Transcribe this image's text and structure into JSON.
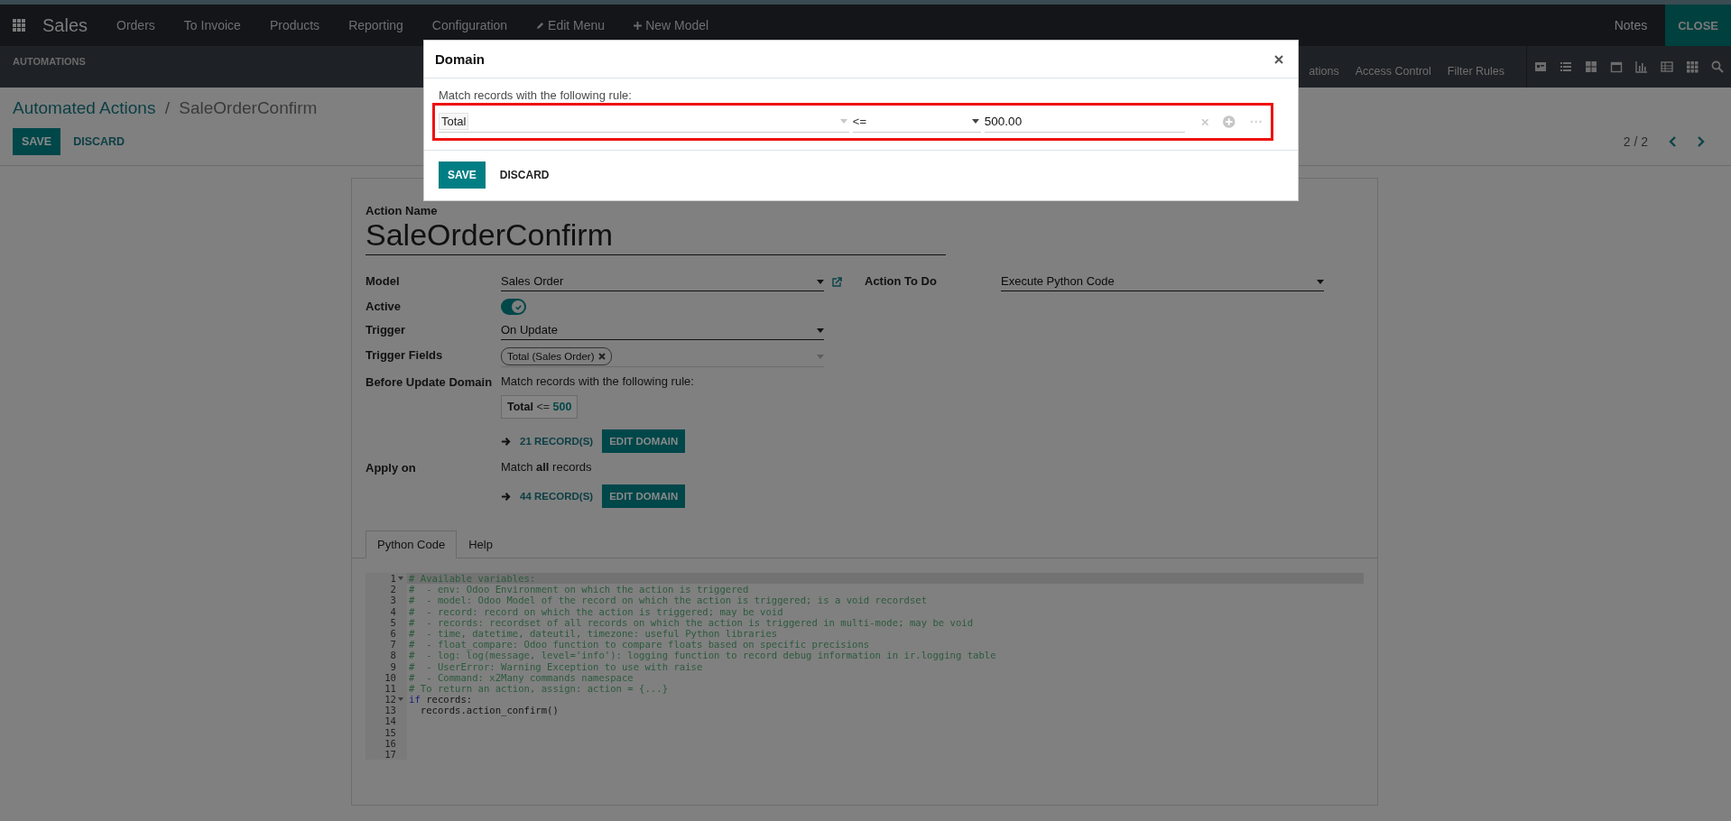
{
  "navbar": {
    "app": "Sales",
    "menu": [
      {
        "label": "Orders"
      },
      {
        "label": "To Invoice"
      },
      {
        "label": "Products"
      },
      {
        "label": "Reporting"
      },
      {
        "label": "Configuration"
      },
      {
        "label": "Edit Menu",
        "kind": "edit"
      },
      {
        "label": "New Model",
        "kind": "new"
      }
    ],
    "notes": "Notes",
    "close": "CLOSE"
  },
  "subnav": {
    "title": "AUTOMATIONS",
    "links": [
      "ations",
      "Access Control",
      "Filter Rules"
    ]
  },
  "breadcrumb": {
    "parent": "Automated Actions",
    "separator": "/",
    "current": "SaleOrderConfirm"
  },
  "buttons": {
    "save": "SAVE",
    "discard": "DISCARD"
  },
  "pager": {
    "text": "2 / 2"
  },
  "form": {
    "name_label": "Action Name",
    "name": "SaleOrderConfirm",
    "model": {
      "label": "Model",
      "value": "Sales Order"
    },
    "action": {
      "label": "Action To Do",
      "value": "Execute Python Code"
    },
    "active": {
      "label": "Active",
      "on": true
    },
    "trigger": {
      "label": "Trigger",
      "value": "On Update"
    },
    "trigger_fields": {
      "label": "Trigger Fields",
      "tags": [
        "Total (Sales Order)"
      ]
    },
    "before_domain": {
      "label": "Before Update Domain",
      "text": "Match records with the following rule:",
      "rule": {
        "field": "Total",
        "operator": "<=",
        "value": "500"
      },
      "records": "21 RECORD(S)",
      "edit": "EDIT DOMAIN"
    },
    "apply_on": {
      "label": "Apply on",
      "text": "Match **all** records",
      "records": "44 RECORD(S)",
      "edit": "EDIT DOMAIN"
    }
  },
  "tabs": [
    {
      "label": "Python Code",
      "selected": true
    },
    {
      "label": "Help",
      "selected": false
    }
  ],
  "code": [
    {
      "number": "1",
      "fold": true,
      "active": true,
      "tokens": [
        {
          "kind": "comment",
          "text": "# Available variables:"
        }
      ]
    },
    {
      "number": "2",
      "fold": false,
      "active": false,
      "tokens": [
        {
          "kind": "comment",
          "text": "#  - env: Odoo Environment on which the action is triggered"
        }
      ]
    },
    {
      "number": "3",
      "fold": false,
      "active": false,
      "tokens": [
        {
          "kind": "comment",
          "text": "#  - model: Odoo Model of the record on which the action is triggered; is a void recordset"
        }
      ]
    },
    {
      "number": "4",
      "fold": false,
      "active": false,
      "tokens": [
        {
          "kind": "comment",
          "text": "#  - record: record on which the action is triggered; may be void"
        }
      ]
    },
    {
      "number": "5",
      "fold": false,
      "active": false,
      "tokens": [
        {
          "kind": "comment",
          "text": "#  - records: recordset of all records on which the action is triggered in multi-mode; may be void"
        }
      ]
    },
    {
      "number": "6",
      "fold": false,
      "active": false,
      "tokens": [
        {
          "kind": "comment",
          "text": "#  - time, datetime, dateutil, timezone: useful Python libraries"
        }
      ]
    },
    {
      "number": "7",
      "fold": false,
      "active": false,
      "tokens": [
        {
          "kind": "comment",
          "text": "#  - float_compare: Odoo function to compare floats based on specific precisions"
        }
      ]
    },
    {
      "number": "8",
      "fold": false,
      "active": false,
      "tokens": [
        {
          "kind": "comment",
          "text": "#  - log: log(message, level='info'): logging function to record debug information in ir.logging table"
        }
      ]
    },
    {
      "number": "9",
      "fold": false,
      "active": false,
      "tokens": [
        {
          "kind": "comment",
          "text": "#  - UserError: Warning Exception to use with raise"
        }
      ]
    },
    {
      "number": "10",
      "fold": false,
      "active": false,
      "tokens": [
        {
          "kind": "comment",
          "text": "#  - Command: x2Many commands namespace"
        }
      ]
    },
    {
      "number": "11",
      "fold": false,
      "active": false,
      "tokens": [
        {
          "kind": "comment",
          "text": "# To return an action, assign: action = {...}"
        }
      ]
    },
    {
      "number": "12",
      "fold": true,
      "active": false,
      "tokens": [
        {
          "kind": "keyword",
          "text": "if"
        },
        {
          "kind": "plain",
          "text": " records:"
        }
      ]
    },
    {
      "number": "13",
      "fold": false,
      "active": false,
      "tokens": [
        {
          "kind": "plain",
          "text": "  records.action_confirm()"
        }
      ]
    },
    {
      "number": "14",
      "fold": false,
      "active": false
    },
    {
      "number": "15",
      "fold": false,
      "active": false
    },
    {
      "number": "16",
      "fold": false,
      "active": false
    },
    {
      "number": "17",
      "fold": false,
      "active": false
    }
  ],
  "dialog": {
    "title": "Domain",
    "text": "Match records with the following rule:",
    "field": "Total",
    "operator": "<=",
    "value": "500.00",
    "save": "SAVE",
    "discard": "DISCARD"
  }
}
